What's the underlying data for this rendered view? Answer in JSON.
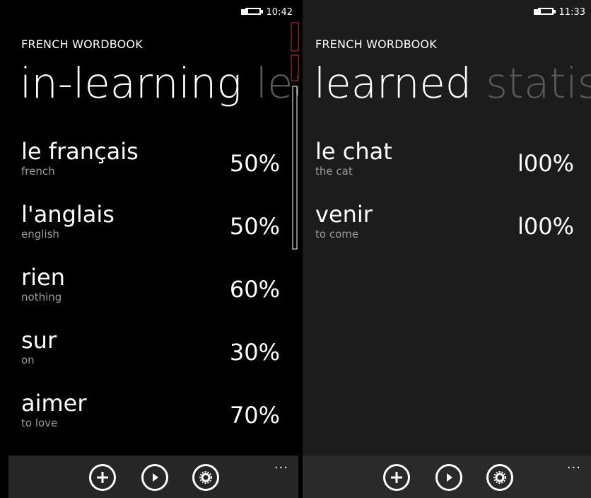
{
  "left": {
    "status_time": "10:42",
    "app_title": "FRENCH WORDBOOK",
    "pivot_active": "in-learning",
    "pivot_next": "lea",
    "words": [
      {
        "word": "le français",
        "translation": "french",
        "percent": "50%"
      },
      {
        "word": "l'anglais",
        "translation": "english",
        "percent": "50%"
      },
      {
        "word": "rien",
        "translation": "nothing",
        "percent": "60%"
      },
      {
        "word": "sur",
        "translation": "on",
        "percent": "30%"
      },
      {
        "word": "aimer",
        "translation": "to love",
        "percent": "70%"
      }
    ],
    "more_label": "..."
  },
  "right": {
    "status_time": "11:33",
    "app_title": "FRENCH WORDBOOK",
    "pivot_active": "learned",
    "pivot_next": "statisti",
    "words": [
      {
        "word": "le chat",
        "translation": "the cat",
        "percent": "l00%"
      },
      {
        "word": "venir",
        "translation": "to come",
        "percent": "l00%"
      }
    ],
    "more_label": "..."
  },
  "icons": [
    "battery-charging-icon",
    "add-icon",
    "play-icon",
    "settings-icon",
    "more-icon"
  ],
  "colors": {
    "background": "#000000",
    "right_background": "#1c1c1c",
    "appbar": "#262626",
    "text": "#ffffff",
    "subtext": "#9a9a9a",
    "pivot_inactive": "#5a5a5a"
  }
}
